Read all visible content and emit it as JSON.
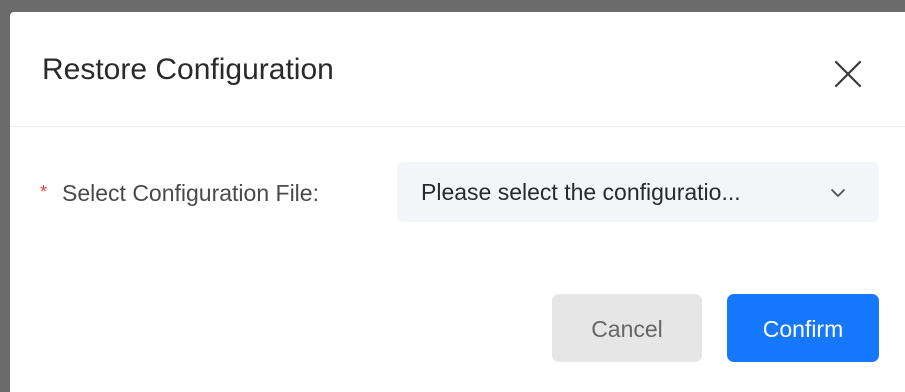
{
  "dialog": {
    "title": "Restore Configuration",
    "close_icon": "close-icon"
  },
  "form": {
    "required_mark": "*",
    "label": "Select Configuration File:",
    "select": {
      "placeholder": "Please select the configuratio...",
      "arrow_icon": "chevron-down-icon"
    }
  },
  "footer": {
    "cancel_label": "Cancel",
    "confirm_label": "Confirm"
  },
  "colors": {
    "primary": "#1677ff",
    "required": "#f04134",
    "cancel_bg": "#e6e6e6",
    "select_bg": "#f3f5f8",
    "overlay": "#6b6b6b"
  }
}
